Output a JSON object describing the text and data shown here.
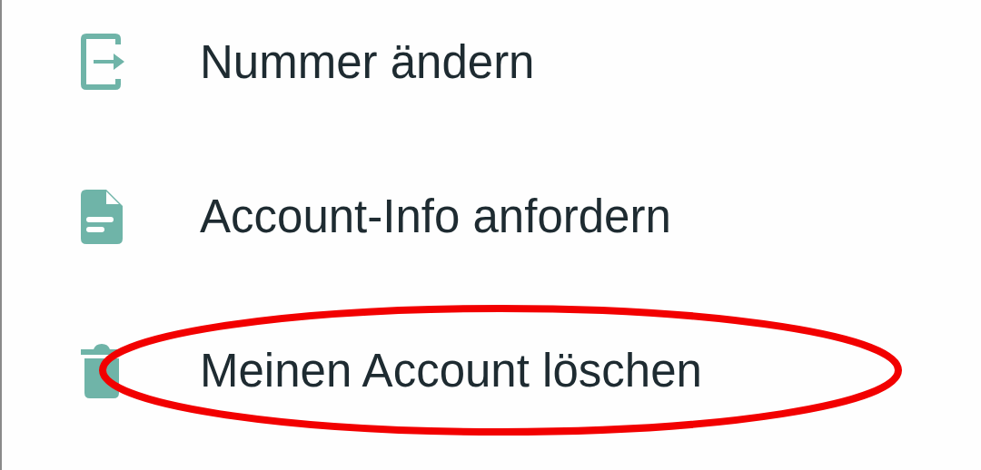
{
  "menu": {
    "items": [
      {
        "kind": "phone-exit",
        "label": "Nummer ändern",
        "highlighted": false
      },
      {
        "kind": "document",
        "label": "Account-Info anfordern",
        "highlighted": false
      },
      {
        "kind": "trash",
        "label": "Meinen Account löschen",
        "highlighted": true
      }
    ]
  }
}
